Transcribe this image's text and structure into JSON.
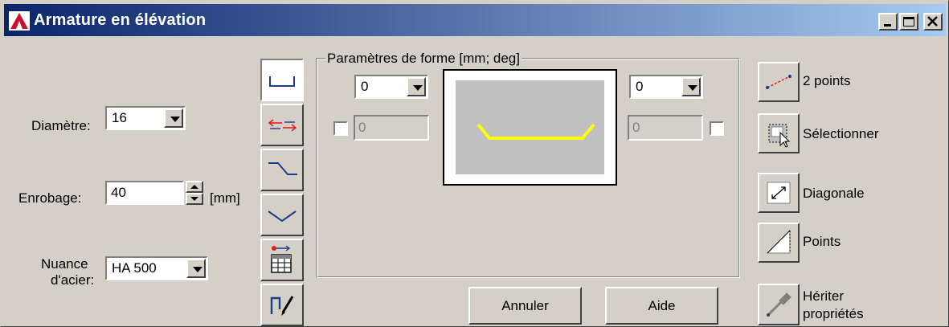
{
  "window": {
    "title": "Armature en élévation",
    "icons": {
      "app": "autocad-logo-icon",
      "minimize": "minimize-icon",
      "maximize": "maximize-icon",
      "close": "close-icon"
    }
  },
  "left": {
    "diametre_label": "Diamètre:",
    "diametre_value": "16",
    "enrobage_label": "Enrobage:",
    "enrobage_value": "40",
    "enrobage_unit": "[mm]",
    "nuance_label_line1": "Nuance",
    "nuance_label_line2": "d'acier:",
    "nuance_value": "HA 500"
  },
  "toolbar": {
    "items": [
      "u-shape-icon",
      "flip-arrows-icon",
      "crank-icon",
      "bend-icon",
      "table-edit-icon",
      "pencil-shape-icon"
    ]
  },
  "shape_params": {
    "group_title": "Paramètres de forme [mm; deg]",
    "left_combo_value": "0",
    "right_combo_value": "0",
    "left_field_value": "0",
    "right_field_value": "0",
    "preview_color": "#ffff00"
  },
  "buttons": {
    "cancel": "Annuler",
    "help": "Aide"
  },
  "side": {
    "two_points": "2 points",
    "select": "Sélectionner",
    "diagonal": "Diagonale",
    "points": "Points",
    "inherit_line1": "Hériter",
    "inherit_line2": "propriétés"
  }
}
